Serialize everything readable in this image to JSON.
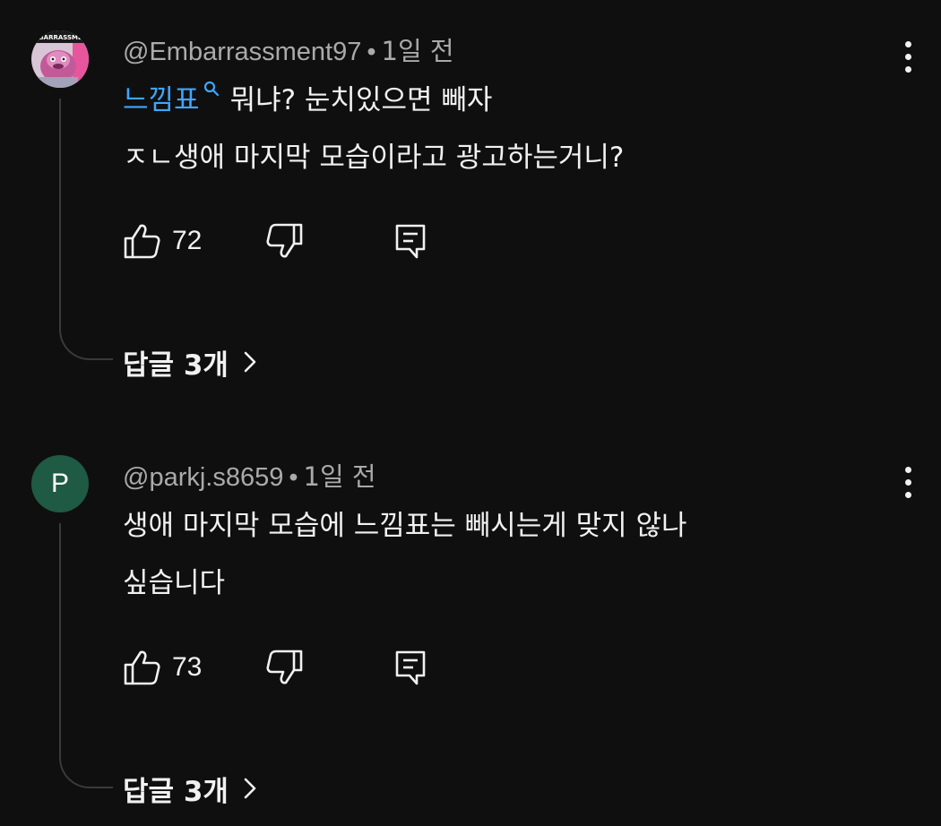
{
  "comments": [
    {
      "handle": "@Embarrassment97",
      "separator": "•",
      "time": "1일 전",
      "avatar_text": "EMBARRASSMENT",
      "hashtag": "느낌표",
      "line1_rest": "뭐냐? 눈치있으면 빼자",
      "line2": "ㅈㄴ생애 마지막 모습이라고 광고하는거니?",
      "likes": "72",
      "replies_label": "답글 3개"
    },
    {
      "handle": "@parkj.s8659",
      "separator": "•",
      "time": "1일 전",
      "avatar_letter": "P",
      "line1": "생애 마지막 모습에 느낌표는 빼시는게 맞지 않나",
      "line2": "싶습니다",
      "likes": "73",
      "replies_label": "답글 3개"
    }
  ],
  "colors": {
    "background": "#0f0f0f",
    "text": "#f1f1f1",
    "meta": "#aaaaaa",
    "link": "#3ea6ff",
    "avatar_p": "#1f5a45",
    "thread_line": "#3a3a3a"
  },
  "icons": [
    "thumb-up-icon",
    "thumb-down-icon",
    "reply-comment-icon",
    "more-vert-icon",
    "search-icon",
    "chevron-right-icon"
  ]
}
